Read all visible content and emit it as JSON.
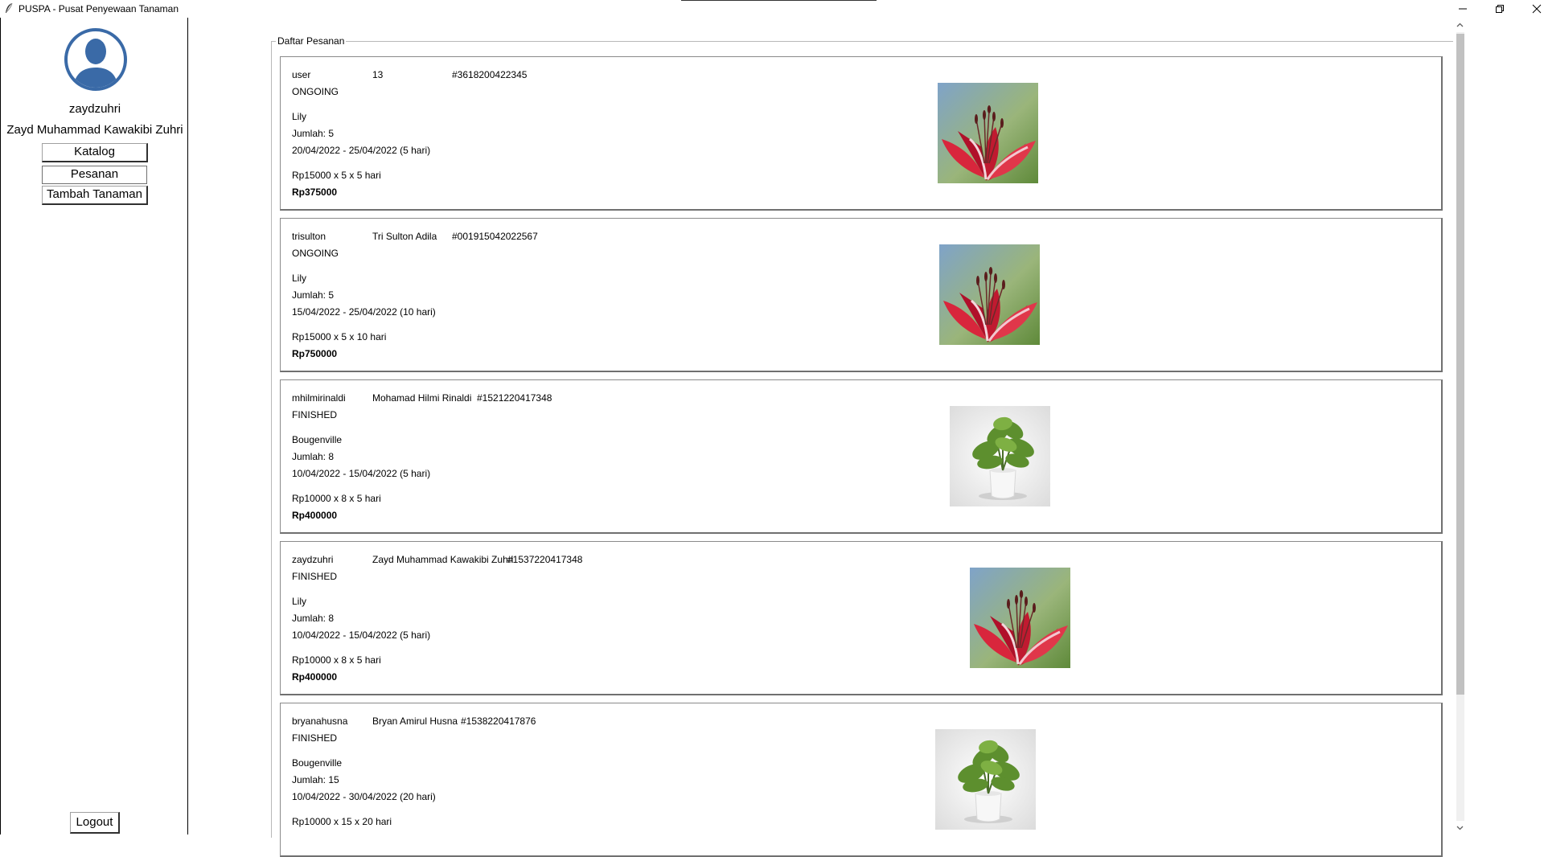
{
  "window": {
    "title": "PUSPA - Pusat Penyewaan Tanaman",
    "app_icon": "feather-icon",
    "controls": {
      "minimize": "minimize-icon",
      "restore": "restore-icon",
      "close": "close-icon"
    }
  },
  "sidebar": {
    "avatar_icon": "user-avatar-icon",
    "username": "zaydzuhri",
    "fullname": "Zayd Muhammad Kawakibi Zuhri",
    "buttons": {
      "katalog": "Katalog",
      "pesanan": "Pesanan",
      "tambah": "Tambah Tanaman",
      "logout": "Logout"
    }
  },
  "main": {
    "legend": "Daftar Pesanan",
    "orders": [
      {
        "user": "user",
        "name": "13",
        "id": "#3618200422345",
        "status": "ONGOING",
        "plant": "Lily",
        "qty": "Jumlah: 5",
        "dates": "20/04/2022 - 25/04/2022 (5 hari)",
        "calc": "Rp15000 x 5 x 5 hari",
        "total": "Rp375000",
        "image": "lily"
      },
      {
        "user": "trisulton",
        "name": "Tri Sulton Adila",
        "id": "#001915042022567",
        "status": "ONGOING",
        "plant": "Lily",
        "qty": "Jumlah: 5",
        "dates": "15/04/2022 - 25/04/2022 (10 hari)",
        "calc": "Rp15000 x 5 x 10 hari",
        "total": "Rp750000",
        "image": "lily"
      },
      {
        "user": "mhilmirinaldi",
        "name": "Mohamad Hilmi Rinaldi",
        "id": "#1521220417348",
        "status": "FINISHED",
        "plant": "Bougenville",
        "qty": "Jumlah: 8",
        "dates": "10/04/2022 - 15/04/2022 (5 hari)",
        "calc": "Rp10000 x 8 x 5 hari",
        "total": "Rp400000",
        "image": "potted-plant"
      },
      {
        "user": "zaydzuhri",
        "name": "Zayd Muhammad Kawakibi Zuhri",
        "id": "#1537220417348",
        "status": "FINISHED",
        "plant": "Lily",
        "qty": "Jumlah: 8",
        "dates": "10/04/2022 - 15/04/2022 (5 hari)",
        "calc": "Rp10000 x 8 x 5 hari",
        "total": "Rp400000",
        "image": "lily"
      },
      {
        "user": "bryanahusna",
        "name": "Bryan Amirul Husna",
        "id": "#1538220417876",
        "status": "FINISHED",
        "plant": "Bougenville",
        "qty": "Jumlah: 15",
        "dates": "10/04/2022 - 30/04/2022 (20 hari)",
        "calc": "Rp10000 x 15 x 20 hari",
        "total": "",
        "image": "potted-plant"
      }
    ]
  }
}
